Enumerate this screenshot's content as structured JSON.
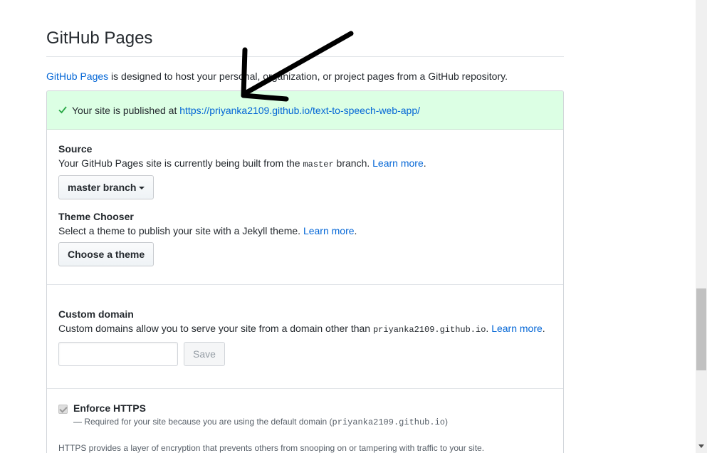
{
  "pages": {
    "title": "GitHub Pages",
    "intro_link": "GitHub Pages",
    "intro_text": " is designed to host your personal, organization, or project pages from a GitHub repository.",
    "published": {
      "prefix": "Your site is published at ",
      "url": "https://priyanka2109.github.io/text-to-speech-web-app/"
    },
    "source": {
      "label": "Source",
      "note_prefix": "Your GitHub Pages site is currently being built from the ",
      "branch_code": "master",
      "note_suffix": " branch. ",
      "learn_more": "Learn more",
      "period": ".",
      "button": "master branch"
    },
    "theme": {
      "label": "Theme Chooser",
      "note": "Select a theme to publish your site with a Jekyll theme. ",
      "learn_more": "Learn more",
      "period": ".",
      "button": "Choose a theme"
    },
    "custom_domain": {
      "label": "Custom domain",
      "note_prefix": "Custom domains allow you to serve your site from a domain other than ",
      "domain_code": "priyanka2109.github.io",
      "note_suffix": ". ",
      "learn_more": "Learn more",
      "period": ".",
      "input_value": "",
      "save": "Save"
    },
    "https": {
      "label": "Enforce HTTPS",
      "note_prefix": "— Required for your site because you are using the default domain (",
      "domain_code": "priyanka2109.github.io",
      "note_suffix": ")",
      "description": "HTTPS provides a layer of encryption that prevents others from snooping on or tampering with traffic to your site."
    }
  },
  "colors": {
    "link": "#0366d6",
    "success_bg": "#dcffe4",
    "check": "#28a745"
  },
  "icons": {
    "check": "check-icon",
    "caret": "caret-down-icon",
    "annotation": "annotation-arrow"
  }
}
